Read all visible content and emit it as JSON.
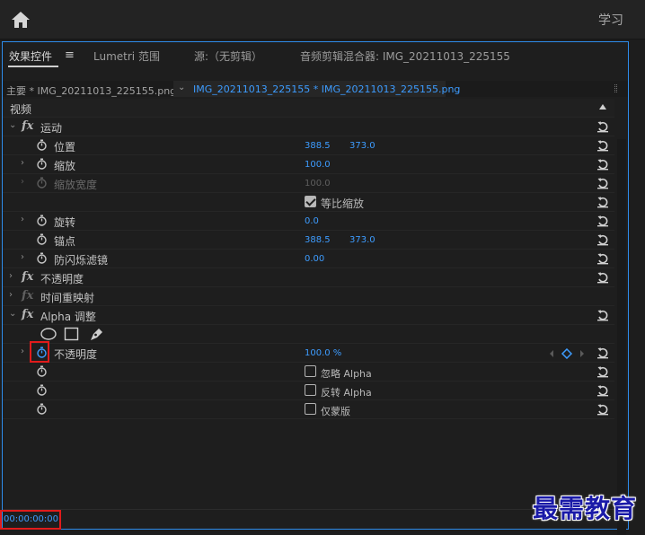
{
  "topbar": {
    "learn_label": "学习"
  },
  "tabs": [
    {
      "label": "效果控件"
    },
    {
      "label": "Lumetri 范围"
    },
    {
      "label": "源:（无剪辑）"
    },
    {
      "label": "音频剪辑混合器: IMG_20211013_225155"
    }
  ],
  "tab_menu": "≡",
  "source": {
    "main": "主要 * IMG_20211013_225155.png",
    "clip": "IMG_20211013_225155 * IMG_20211013_225155.png"
  },
  "section_video": "视频",
  "motion": {
    "label": "运动",
    "position": {
      "label": "位置",
      "x": "388.5",
      "y": "373.0"
    },
    "scale": {
      "label": "缩放",
      "value": "100.0"
    },
    "scale_width": {
      "label": "缩放宽度",
      "value": "100.0"
    },
    "uniform_scale": {
      "label": "等比缩放",
      "checked": true
    },
    "rotation": {
      "label": "旋转",
      "value": "0.0"
    },
    "anchor": {
      "label": "锚点",
      "x": "388.5",
      "y": "373.0"
    },
    "antiflicker": {
      "label": "防闪烁滤镜",
      "value": "0.00"
    }
  },
  "opacity_effect": {
    "label": "不透明度"
  },
  "time_remap": {
    "label": "时间重映射"
  },
  "alpha_adjust": {
    "label": "Alpha 调整",
    "opacity": {
      "label": "不透明度",
      "value": "100.0 %"
    },
    "ignore_alpha": {
      "label": "忽略 Alpha",
      "checked": false
    },
    "invert_alpha": {
      "label": "反转 Alpha",
      "checked": false
    },
    "mask_only": {
      "label": "仅蒙版",
      "checked": false
    }
  },
  "fx_symbol": "fx",
  "timecode": "00:00:00:00",
  "watermark": "最需教育",
  "colors": {
    "accent_blue": "#3d9cff",
    "highlight_red": "#e01b1b",
    "panel_border": "#2d8ceb"
  }
}
